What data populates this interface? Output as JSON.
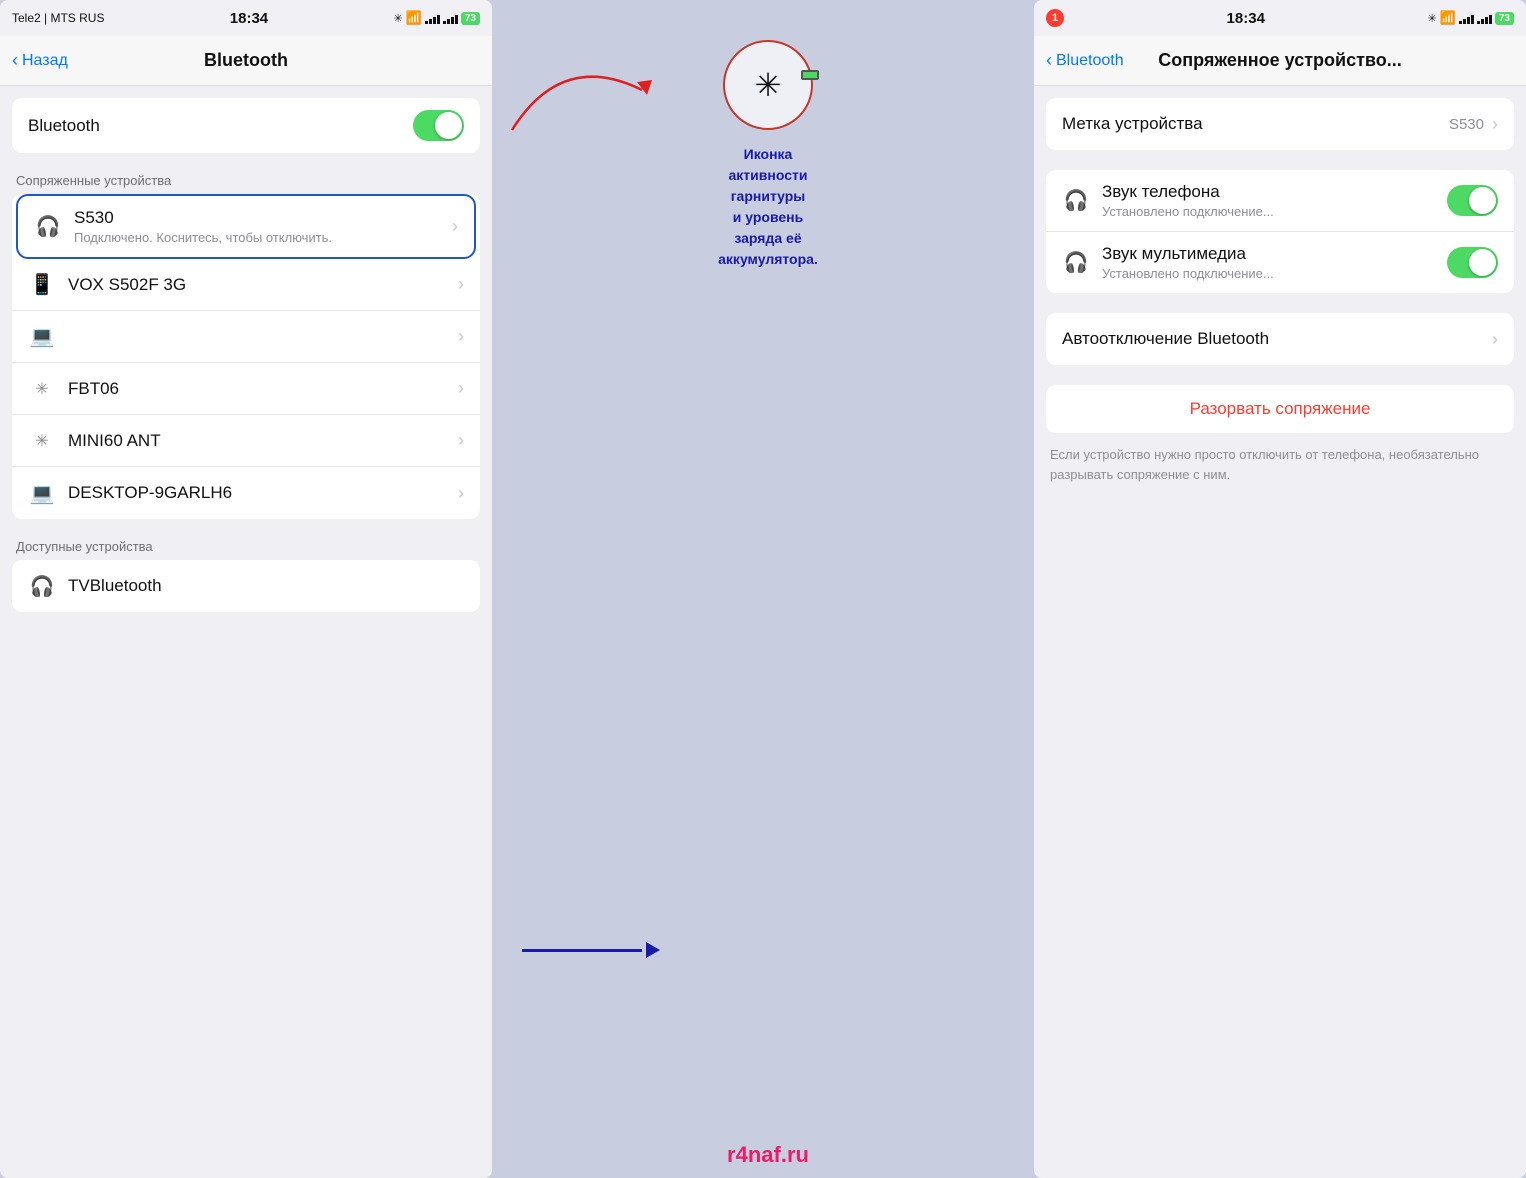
{
  "left_screen": {
    "status_bar": {
      "carrier": "Tele2 | MTS RUS",
      "time": "18:34",
      "battery": "73"
    },
    "nav": {
      "back_label": "Назад",
      "title": "Bluetooth"
    },
    "bluetooth_toggle": {
      "label": "Bluetooth",
      "state": "on"
    },
    "paired_section_label": "Сопряженные устройства",
    "paired_devices": [
      {
        "id": "s530",
        "icon": "headphones",
        "name": "S530",
        "subtitle": "Подключено. Коснитесь, чтобы отключить.",
        "has_chevron": true
      },
      {
        "id": "vox",
        "icon": "phone",
        "name": "VOX S502F 3G",
        "subtitle": "",
        "has_chevron": true
      },
      {
        "id": "unknown",
        "icon": "laptop",
        "name": "",
        "subtitle": "",
        "has_chevron": true
      },
      {
        "id": "fbt06",
        "icon": "bluetooth",
        "name": "FBT06",
        "subtitle": "",
        "has_chevron": true
      },
      {
        "id": "mini60",
        "icon": "bluetooth",
        "name": "MINI60 ANT",
        "subtitle": "",
        "has_chevron": true
      },
      {
        "id": "desktop",
        "icon": "laptop",
        "name": "DESKTOP-9GARLH6",
        "subtitle": "",
        "has_chevron": true
      }
    ],
    "available_section_label": "Доступные устройства",
    "available_devices": [
      {
        "id": "tvbluetooth",
        "icon": "headphones",
        "name": "TVBluetooth",
        "subtitle": ""
      }
    ]
  },
  "right_screen": {
    "status_bar": {
      "carrier": "",
      "time": "18:34",
      "battery": "73",
      "notification": "1"
    },
    "nav": {
      "back_label": "Bluetooth",
      "title": "Сопряженное устройство..."
    },
    "device_label_label": "Метка устройства",
    "device_label_value": "S530",
    "rows": [
      {
        "id": "phone_sound",
        "icon": "headphones",
        "title": "Звук телефона",
        "subtitle": "Установлено подключение...",
        "toggle": true
      },
      {
        "id": "media_sound",
        "icon": "headphones",
        "title": "Звук мультимедиа",
        "subtitle": "Установлено подключение...",
        "toggle": true
      }
    ],
    "auto_disconnect_label": "Автоотключение Bluetooth",
    "disconnect_btn_label": "Разорвать сопряжение",
    "disconnect_note": "Если устройство нужно просто отключить от телефона, необязательно разрывать сопряжение с ним."
  },
  "annotation": {
    "text": "Иконка\nактивности\nгарнитуры\nи уровень\nзаряда её\nаккумулятора."
  },
  "watermark": "r4naf.ru"
}
